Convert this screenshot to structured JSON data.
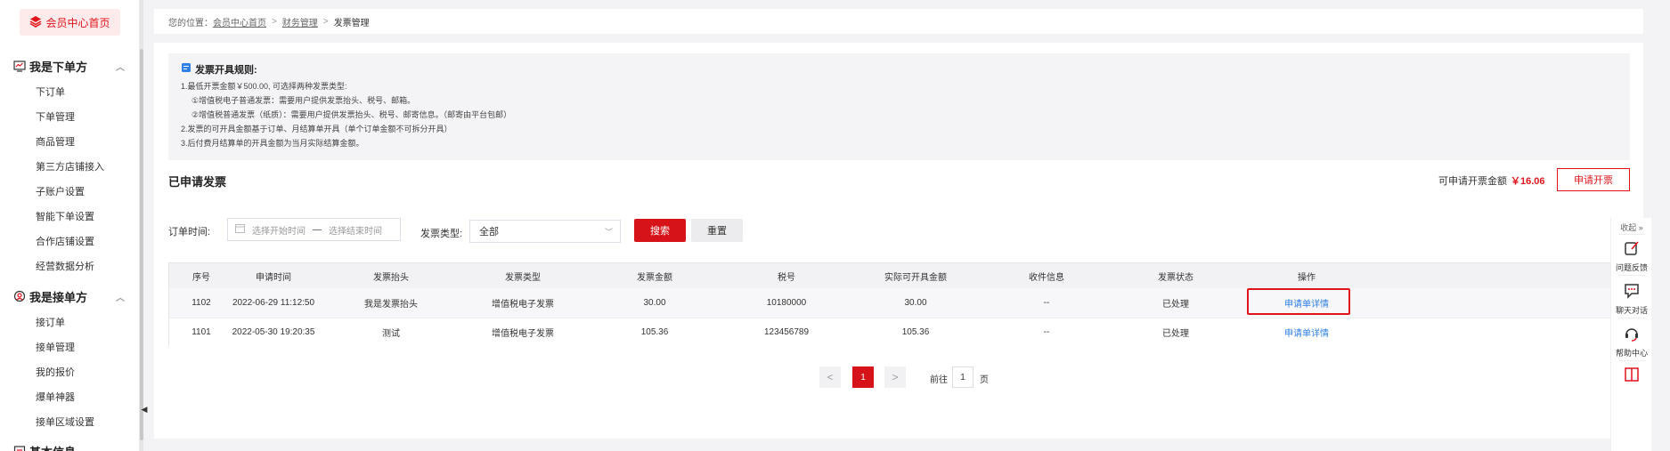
{
  "sidebar": {
    "home_label": "会员中心首页",
    "groups": [
      {
        "title": "我是下单方",
        "items": [
          "下订单",
          "下单管理",
          "商品管理",
          "第三方店铺接入",
          "子账户设置",
          "智能下单设置",
          "合作店铺设置",
          "经营数据分析"
        ]
      },
      {
        "title": "我是接单方",
        "items": [
          "接订单",
          "接单管理",
          "我的报价",
          "爆单神器",
          "接单区域设置"
        ]
      },
      {
        "title": "基本信息",
        "items": []
      }
    ]
  },
  "breadcrumb": {
    "prefix": "您的位置：",
    "home": "会员中心首页",
    "finance": "财务管理",
    "current": "发票管理"
  },
  "rules": {
    "title": "发票开具规则:",
    "lines": [
      "1.最低开票金额￥500.00, 可选择两种发票类型:",
      "①增值税电子普通发票：需要用户提供发票抬头、税号、邮箱。",
      "②增值税普通发票（纸质）：需要用户提供发票抬头、税号、邮寄信息。（邮寄由平台包邮）",
      "2.发票的可开具金额基于订单、月结算单开具（单个订单金额不可拆分开具）",
      "3.后付费月结算单的开具金额为当月实际结算金额。"
    ]
  },
  "section": {
    "title": "已申请发票",
    "available_label": "可申请开票金额",
    "available_amount": "￥16.06",
    "apply_button": "申请开票"
  },
  "filters": {
    "order_time_label": "订单时间:",
    "start_placeholder": "选择开始时间",
    "range_sep": "—",
    "end_placeholder": "选择结束时间",
    "invoice_type_label": "发票类型:",
    "invoice_type_value": "全部",
    "search_button": "搜索",
    "reset_button": "重置"
  },
  "table": {
    "columns": [
      "序号",
      "申请时间",
      "发票抬头",
      "发票类型",
      "发票金额",
      "税号",
      "实际可开具金额",
      "收件信息",
      "发票状态",
      "操作"
    ],
    "rows": [
      [
        "1102",
        "2022-06-29 11:12:50",
        "我是发票抬头",
        "增值税电子发票",
        "30.00",
        "10180000",
        "30.00",
        "--",
        "已处理",
        "申请单详情"
      ],
      [
        "1101",
        "2022-05-30 19:20:35",
        "测试",
        "增值税电子发票",
        "105.36",
        "123456789",
        "105.36",
        "--",
        "已处理",
        "申请单详情"
      ]
    ]
  },
  "pagination": {
    "prev": "<",
    "current": "1",
    "next": ">",
    "goto_label": "前往",
    "goto_value": "1",
    "page_suffix": "页"
  },
  "right_toolbar": {
    "collapse": "收起 »",
    "items": [
      "问题反馈",
      "聊天对话",
      "帮助中心"
    ]
  },
  "colors": {
    "accent": "#d7131a",
    "link": "#2f7fe6"
  }
}
